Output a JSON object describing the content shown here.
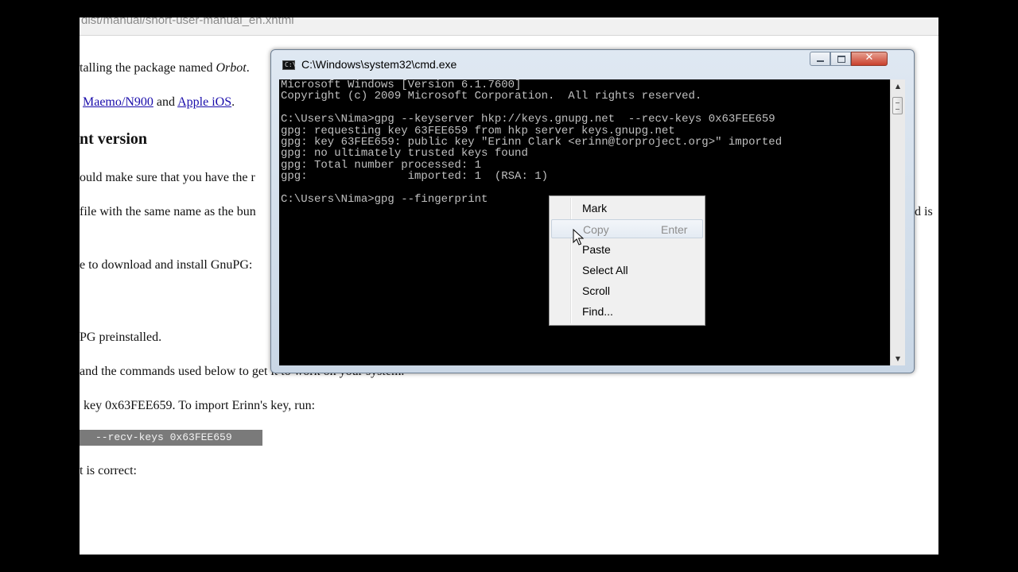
{
  "background": {
    "url": "dist/manual/short-user-manual_en.xhtml",
    "lines": [
      {
        "text": "talling the package named "
      },
      {
        "italic": "Orbot"
      },
      {
        "suffix": "."
      }
    ],
    "link_line": {
      "link1": "Maemo/N900",
      "mid": " and ",
      "link2": "Apple iOS",
      "end": "."
    },
    "heading": "nt version",
    "para1": "ould make sure that you have the r",
    "para2": "file with the same name as the bun",
    "para2_right": "d is",
    "para3": "e to download and install GnuPG:",
    "para4": "PG preinstalled.",
    "para5": "and the commands used below to get it to work on your system.",
    "para6": "key 0x63FEE659. To import Erinn's key, run:",
    "code": "--recv-keys 0x63FEE659",
    "para7": "t is correct:"
  },
  "window": {
    "title": "C:\\Windows\\system32\\cmd.exe",
    "close_label": "✕"
  },
  "console": {
    "text": "Microsoft Windows [Version 6.1.7600]\nCopyright (c) 2009 Microsoft Corporation.  All rights reserved.\n\nC:\\Users\\Nima>gpg --keyserver hkp://keys.gnupg.net  --recv-keys 0x63FEE659\ngpg: requesting key 63FEE659 from hkp server keys.gnupg.net\ngpg: key 63FEE659: public key \"Erinn Clark <erinn@torproject.org>\" imported\ngpg: no ultimately trusted keys found\ngpg: Total number processed: 1\ngpg:               imported: 1  (RSA: 1)\n\nC:\\Users\\Nima>gpg --fingerprint"
  },
  "scrollbar": {
    "up": "▲",
    "down": "▼"
  },
  "context_menu": {
    "items": [
      {
        "label": "Mark",
        "shortcut": "",
        "disabled": false
      },
      {
        "label": "Copy",
        "shortcut": "Enter",
        "disabled": true
      },
      {
        "label": "Paste",
        "shortcut": "",
        "disabled": false
      },
      {
        "label": "Select All",
        "shortcut": "",
        "disabled": false
      },
      {
        "label": "Scroll",
        "shortcut": "",
        "disabled": false
      },
      {
        "label": "Find...",
        "shortcut": "",
        "disabled": false
      }
    ]
  }
}
